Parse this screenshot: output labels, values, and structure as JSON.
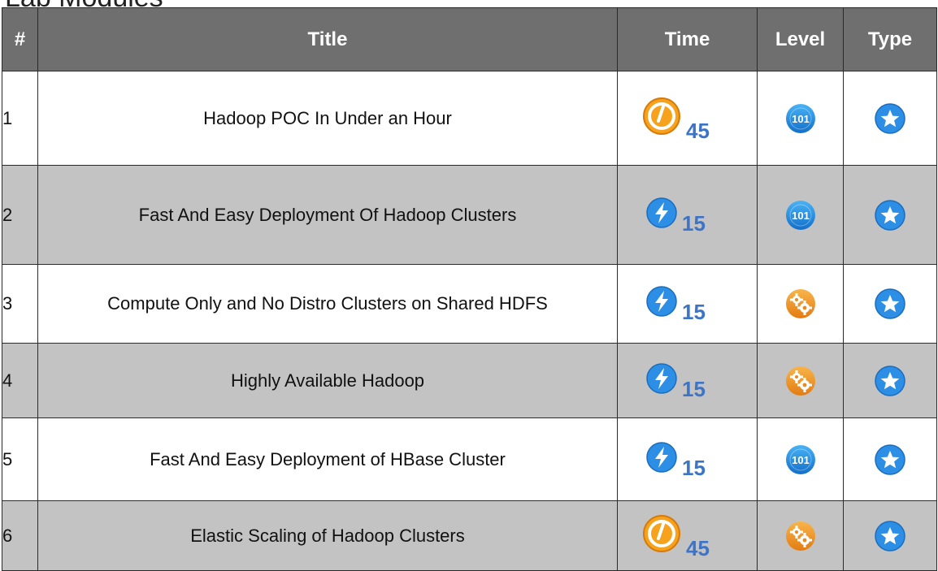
{
  "heading": "Lab Modules",
  "columns": {
    "num": "#",
    "title": "Title",
    "time": "Time",
    "level": "Level",
    "type": "Type"
  },
  "rows": [
    {
      "num": "1",
      "title": "Hadoop POC In Under an Hour",
      "time": "45",
      "time_icon": "clock-icon",
      "level_icon": "level-101-icon",
      "type_icon": "star-icon",
      "shaded": false
    },
    {
      "num": "2",
      "title": "Fast And Easy Deployment Of Hadoop Clusters",
      "time": "15",
      "time_icon": "lightning-icon",
      "level_icon": "level-101-icon",
      "type_icon": "star-icon",
      "shaded": true
    },
    {
      "num": "3",
      "title": "Compute Only and No Distro Clusters on Shared HDFS",
      "time": "15",
      "time_icon": "lightning-icon",
      "level_icon": "gears-icon",
      "type_icon": "star-icon",
      "shaded": false
    },
    {
      "num": "4",
      "title": "Highly Available Hadoop",
      "time": "15",
      "time_icon": "lightning-icon",
      "level_icon": "gears-icon",
      "type_icon": "star-icon",
      "shaded": true
    },
    {
      "num": "5",
      "title": "Fast And Easy Deployment of HBase Cluster",
      "time": "15",
      "time_icon": "lightning-icon",
      "level_icon": "level-101-icon",
      "type_icon": "star-icon",
      "shaded": false
    },
    {
      "num": "6",
      "title": "Elastic Scaling of Hadoop Clusters",
      "time": "45",
      "time_icon": "clock-icon",
      "level_icon": "gears-icon",
      "type_icon": "star-icon",
      "shaded": true
    }
  ],
  "icon_text": {
    "level_101": "101"
  },
  "colors": {
    "header_bg": "#6f6f6f",
    "shaded_row": "#c3c3c3",
    "time_value": "#3d74c8",
    "blue_icon": "#1f8fe0",
    "orange_icon": "#f39a1e"
  }
}
